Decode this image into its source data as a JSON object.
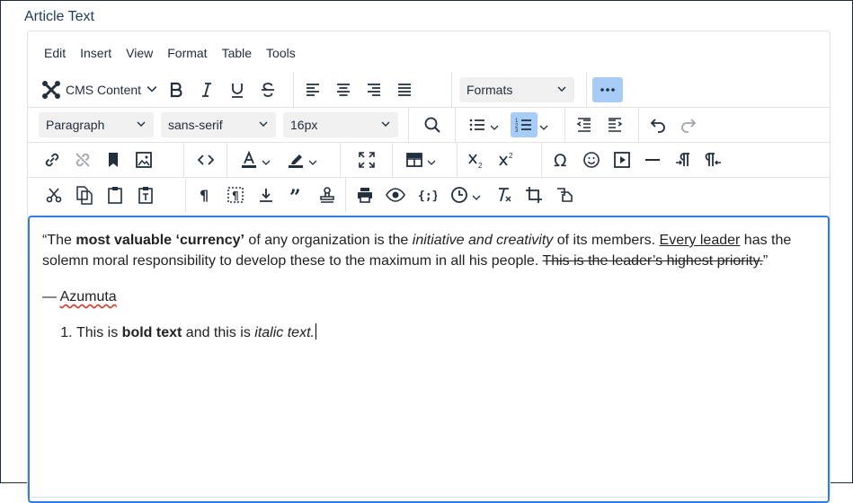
{
  "field_label": "Article Text",
  "menubar": [
    "Edit",
    "Insert",
    "View",
    "Format",
    "Table",
    "Tools"
  ],
  "toolbar": {
    "cms_content": "CMS Content",
    "formats": "Formats",
    "paragraph": "Paragraph",
    "font_family": "sans-serif",
    "font_size": "16px"
  },
  "content": {
    "quote": {
      "open": "“The ",
      "bold": "most valuable ‘currency’",
      "t2": " of any organization is the ",
      "italic": "initiative and creativity",
      "t3": " of its members. ",
      "underlined": "Every leader",
      "t4": " has the solemn moral responsibility to develop these to the maximum in all his people. ",
      "struck": "This is the leader’s highest priority.",
      "close": "”"
    },
    "attribution": {
      "dash": "— ",
      "name": "Azumuta"
    },
    "list_item": {
      "t1": "This is ",
      "bold": "bold text",
      "t2": " and this is ",
      "italic": "italic text."
    }
  }
}
